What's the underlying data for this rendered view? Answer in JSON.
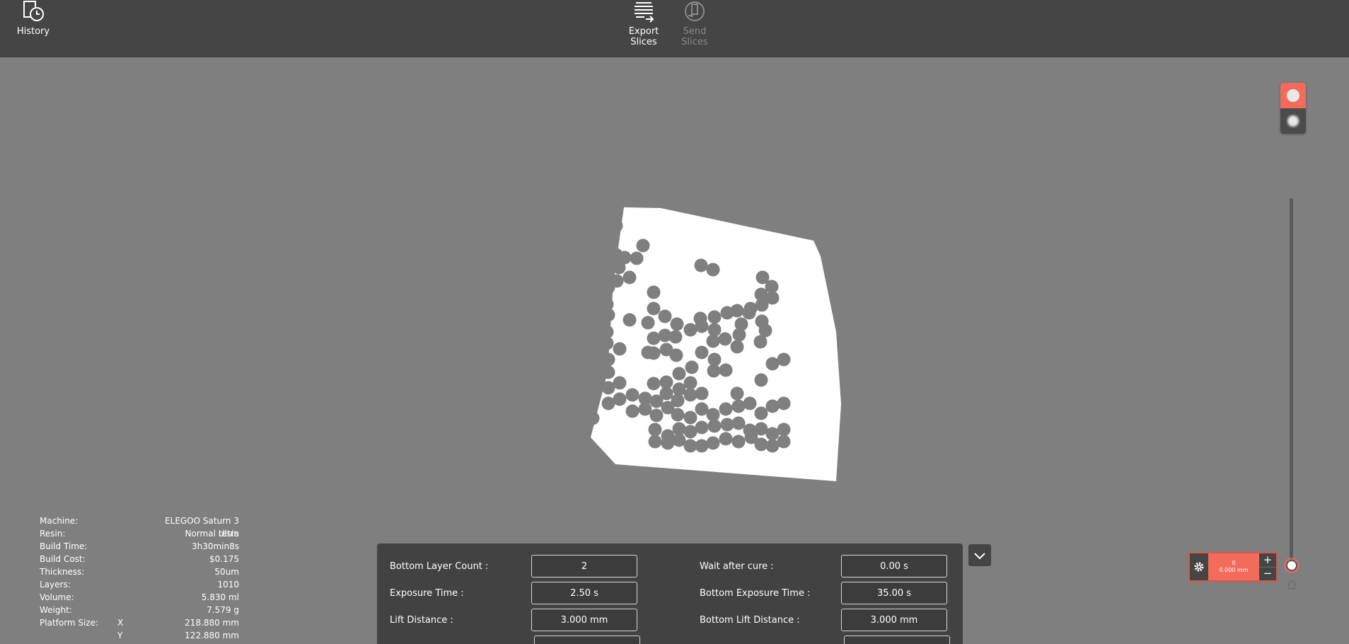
{
  "toolbar": {
    "history_label": "History",
    "export_label": "Export\nSlices",
    "send_label": "Send\nSlices"
  },
  "colors": {
    "accent": "#f26b5b",
    "toolbar_bg": "#454545",
    "viewport_bg": "#7f7f7f",
    "panel_bg": "#424242"
  },
  "layer_control": {
    "layer": "0",
    "height": "0.000 mm",
    "plus": "+",
    "minus": "−"
  },
  "info": {
    "rows": [
      {
        "key": "Machine:",
        "value": "ELEGOO Saturn 3 Ultra"
      },
      {
        "key": "Resin:",
        "value": "Normal resin"
      },
      {
        "key": "Build Time:",
        "value": "3h30min8s"
      },
      {
        "key": "Build Cost:",
        "value": "$0.175"
      },
      {
        "key": "Thickness:",
        "value": "50um"
      },
      {
        "key": "Layers:",
        "value": "1010"
      },
      {
        "key": "Volume:",
        "value": "5.830 ml"
      },
      {
        "key": "Weight:",
        "value": "7.579 g"
      },
      {
        "key": "Platform Size:",
        "axis": "X",
        "value": "218.880 mm"
      },
      {
        "key": "",
        "axis": "Y",
        "value": "122.880 mm"
      }
    ]
  },
  "settings": {
    "left": [
      {
        "label": "Bottom Layer Count :",
        "value": "2"
      },
      {
        "label": "Exposure Time :",
        "value": "2.50 s"
      },
      {
        "label": "Lift Distance :",
        "value": "3.000 mm"
      }
    ],
    "right": [
      {
        "label": "Wait after cure :",
        "value": "0.00 s"
      },
      {
        "label": "Bottom Exposure Time :",
        "value": "35.00 s"
      },
      {
        "label": "Bottom Lift Distance :",
        "value": "3.000 mm"
      }
    ]
  }
}
